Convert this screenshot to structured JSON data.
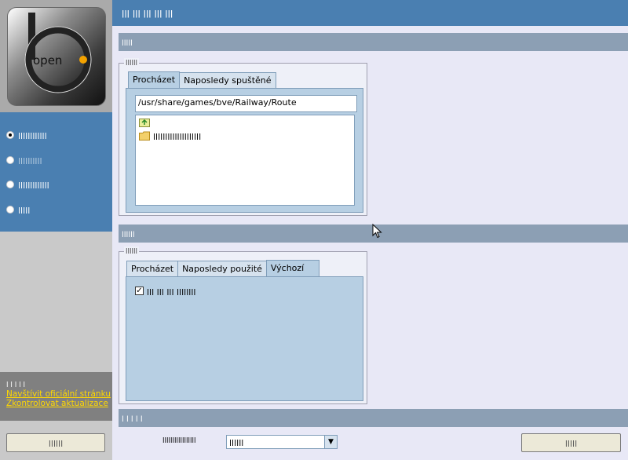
{
  "header": {
    "title": "ꞁꞁꞁ ꞁꞁꞁ ꞁꞁꞁ ꞁꞁꞁ ꞁꞁꞁ"
  },
  "logo": {
    "text": "open"
  },
  "sidebar": {
    "radios": [
      {
        "label": "ꞁꞁꞁꞁꞁꞁꞁꞁꞁꞁꞁꞁ",
        "checked": true
      },
      {
        "label": "ꞁꞁꞁꞁꞁꞁꞁꞁꞁꞁ",
        "checked": false
      },
      {
        "label": "ꞁꞁꞁꞁꞁꞁꞁꞁꞁꞁꞁꞁꞁ",
        "checked": false
      },
      {
        "label": "ꞁꞁꞁꞁꞁ",
        "checked": false
      }
    ],
    "links_heading": "ꞁ ꞁ ꞁ ꞁ ꞁ",
    "link_official": "Navštívit oficiální stránku",
    "link_updates": "Zkontrolovat aktualizace",
    "button_label": "ꞁꞁꞁꞁꞁꞁ"
  },
  "route": {
    "section_title": "ꞁꞁꞁꞁꞁ",
    "group_title": "ꞁꞁꞁꞁꞁꞁ",
    "tabs": [
      "Procházet",
      "Naposledy spuštěné"
    ],
    "path": "/usr/share/games/bve/Railway/Route",
    "items": [
      {
        "icon": "folder-up-icon",
        "label": ""
      },
      {
        "icon": "folder-icon",
        "label": "ꞁꞁꞁꞁꞁꞁꞁꞁꞁꞁꞁꞁꞁꞁꞁꞁꞁꞁꞁꞁ"
      }
    ]
  },
  "train": {
    "section_title": "ꞁꞁꞁꞁꞁꞁ",
    "group_title": "ꞁꞁꞁꞁꞁꞁ",
    "tabs": [
      "Procházet",
      "Naposledy použité",
      "Výchozí"
    ],
    "checkbox_label": "ꞁꞁꞁ ꞁꞁꞁ ꞁꞁꞁ ꞁꞁꞁꞁꞁꞁꞁꞁ",
    "checkbox_checked": true
  },
  "bottom": {
    "section_title": "ꞁ ꞁ ꞁ ꞁ ꞁ",
    "language_label": "ꞁꞁꞁꞁꞁꞁꞁꞁꞁꞁꞁꞁꞁꞁꞁꞁꞁ",
    "language_value": "ꞁꞁꞁꞁꞁꞁ",
    "start_label": "ꞁꞁꞁꞁꞁ"
  },
  "colors": {
    "header_blue": "#4a7fb1",
    "section_gray": "#8c9fb4",
    "tab_pane": "#b7cfe3",
    "link_yellow": "#ffd800"
  }
}
